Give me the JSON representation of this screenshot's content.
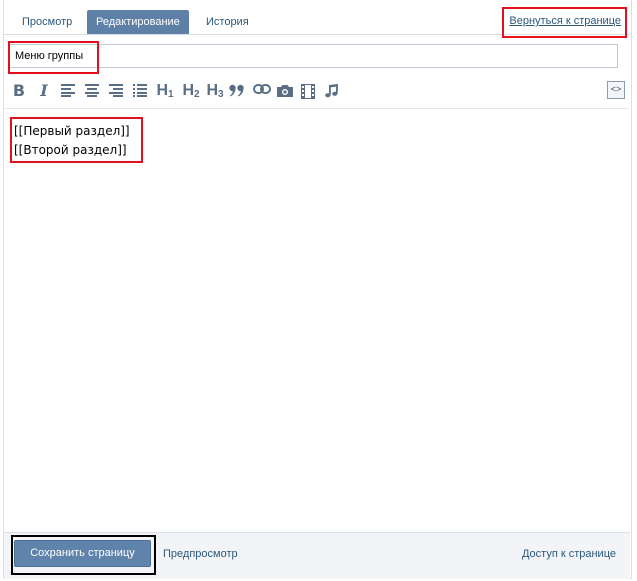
{
  "tabs": [
    {
      "label": "Просмотр",
      "active": false
    },
    {
      "label": "Редактирование",
      "active": true
    },
    {
      "label": "История",
      "active": false
    }
  ],
  "back_link": "Вернуться к странице",
  "title_value": "Меню группы",
  "toolbar": {
    "bold": "B",
    "italic": "I",
    "h1": "H",
    "h1_sub": "1",
    "h2": "H",
    "h2_sub": "2",
    "h3": "H",
    "h3_sub": "3",
    "quote": "99",
    "source_toggle": "<>",
    "icons": [
      "bold-icon",
      "italic-icon",
      "align-left-icon",
      "align-center-icon",
      "align-right-icon",
      "list-icon",
      "h1-icon",
      "h2-icon",
      "h3-icon",
      "quote-icon",
      "link-icon",
      "photo-icon",
      "video-icon",
      "audio-icon",
      "source-code-icon"
    ]
  },
  "editor_lines": [
    "[[Первый раздел]]",
    "[[Второй раздел]]"
  ],
  "footer": {
    "save_label": "Сохранить страницу",
    "preview_label": "Предпросмотр",
    "access_label": "Доступ к странице"
  },
  "colors": {
    "accent": "#5e80a6",
    "link": "#2b587a",
    "highlight_red": "#e3111e",
    "highlight_black": "#000000"
  }
}
